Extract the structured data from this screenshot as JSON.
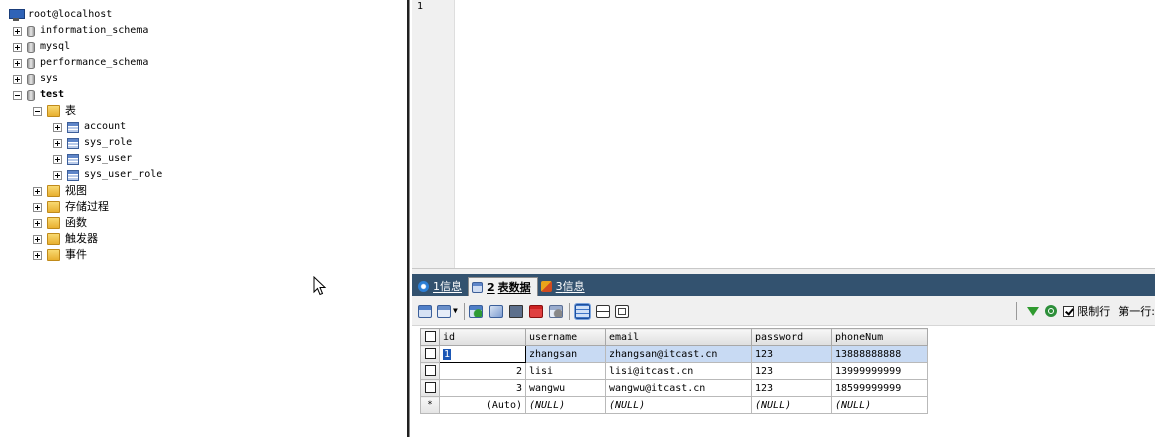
{
  "tree": {
    "server": "root@localhost",
    "databases": [
      {
        "name": "information_schema",
        "expanded": false
      },
      {
        "name": "mysql",
        "expanded": false
      },
      {
        "name": "performance_schema",
        "expanded": false
      },
      {
        "name": "sys",
        "expanded": false
      },
      {
        "name": "test",
        "expanded": true
      }
    ],
    "test_folders": {
      "tables_label": "表",
      "tables": [
        "account",
        "sys_role",
        "sys_user",
        "sys_user_role"
      ],
      "views_label": "视图",
      "procedures_label": "存储过程",
      "functions_label": "函数",
      "triggers_label": "触发器",
      "events_label": "事件"
    }
  },
  "editor": {
    "line_numbers": [
      "1"
    ]
  },
  "result_tabs": [
    {
      "num": "1",
      "label": "信息",
      "active": false
    },
    {
      "num": "2",
      "label": "表数据",
      "active": true
    },
    {
      "num": "3",
      "label": "信息",
      "active": false
    }
  ],
  "toolbar": {
    "limit_rows_label": "限制行",
    "limit_rows_checked": true,
    "first_row_label": "第一行:"
  },
  "grid": {
    "columns": [
      "id",
      "username",
      "email",
      "password",
      "phoneNum"
    ],
    "rows": [
      {
        "id": "1",
        "username": "zhangsan",
        "email": "zhangsan@itcast.cn",
        "password": "123",
        "phoneNum": "13888888888"
      },
      {
        "id": "2",
        "username": "lisi",
        "email": "lisi@itcast.cn",
        "password": "123",
        "phoneNum": "13999999999"
      },
      {
        "id": "3",
        "username": "wangwu",
        "email": "wangwu@itcast.cn",
        "password": "123",
        "phoneNum": "18599999999"
      }
    ],
    "new_row": {
      "marker": "*",
      "id": "(Auto)",
      "username": "(NULL)",
      "email": "(NULL)",
      "password": "(NULL)",
      "phoneNum": "(NULL)"
    }
  },
  "colors": {
    "tab_bar_bg": "#33526f",
    "selected_row_bg": "#c8daf3",
    "edit_cell_highlight": "#1b57b5"
  }
}
